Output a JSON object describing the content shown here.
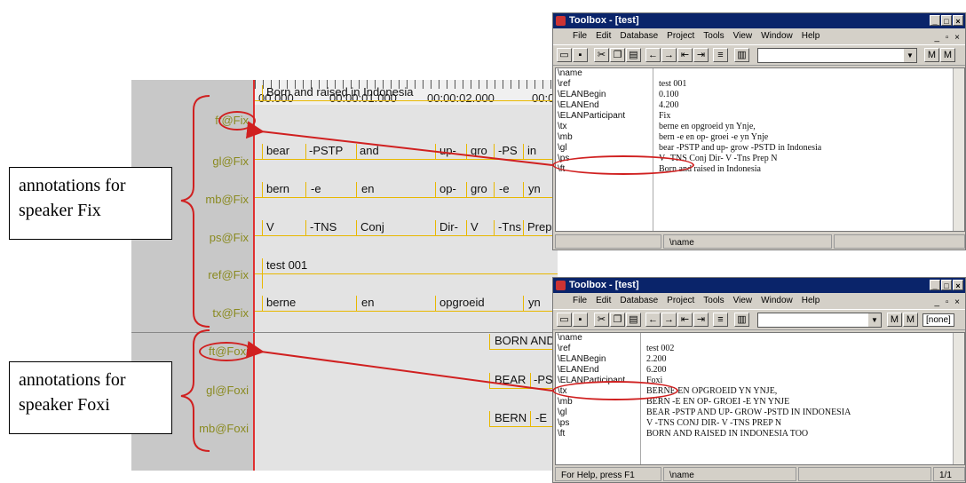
{
  "elan": {
    "ruler": [
      "00.000",
      "00:00:01.000",
      "00:00:02.000",
      "00:0"
    ],
    "tiers": [
      {
        "label": "ft@Fix"
      },
      {
        "label": "gl@Fix"
      },
      {
        "label": "mb@Fix"
      },
      {
        "label": "ps@Fix"
      },
      {
        "label": "ref@Fix"
      },
      {
        "label": "tx@Fix"
      },
      {
        "label": "ft@Foxi"
      },
      {
        "label": "gl@Foxi"
      },
      {
        "label": "mb@Foxi"
      }
    ],
    "ft_fix": "Born and raised in Indonesia",
    "gl_fix": [
      "bear",
      "-PSTP",
      "and",
      "up-",
      "gro",
      "-PS",
      "in"
    ],
    "mb_fix": [
      "bern",
      "-e",
      "en",
      "op-",
      "gro",
      "-e",
      "yn"
    ],
    "ps_fix": [
      "V",
      "-TNS",
      "Conj",
      "Dir-",
      "V",
      "-Tns",
      "Prep"
    ],
    "ref_fix": "test 001",
    "tx_fix": [
      "berne",
      "en",
      "opgroeid",
      "yn"
    ],
    "ft_foxi": "BORN AND",
    "gl_foxi": [
      "BEAR",
      "-PS"
    ],
    "mb_foxi": [
      "BERN",
      "-E"
    ]
  },
  "callouts": {
    "fix": "annotations for speaker Fix",
    "foxi": "annotations for speaker Foxi"
  },
  "toolbox1": {
    "title": "Toolbox - [test]",
    "menu": [
      "File",
      "Edit",
      "Database",
      "Project",
      "Tools",
      "View",
      "Window",
      "Help"
    ],
    "fields": [
      "\\name",
      "\\ref",
      "\\ELANBegin",
      "\\ELANEnd",
      "\\ELANParticipant",
      "\\tx",
      "\\mb",
      "\\gl",
      "\\ps",
      "\\ft"
    ],
    "values": [
      "",
      "test 001",
      "0.100",
      "4.200",
      "Fix",
      "berne    en  opgroeid     yn  Ynje,",
      "bern -e    en  op- groei -e   yn  Ynje",
      "bear -PSTP and  up- grow  -PSTD in   Indonesia",
      "V    -TNS  Conj Dir- V    -Tns  Prep N",
      "Born and raised in Indonesia"
    ],
    "status": "\\name"
  },
  "toolbox2": {
    "title": "Toolbox - [test]",
    "menu": [
      "File",
      "Edit",
      "Database",
      "Project",
      "Tools",
      "View",
      "Window",
      "Help"
    ],
    "combo_value": "[none]",
    "fields": [
      "\\name",
      "\\ref",
      "\\ELANBegin",
      "\\ELANEnd",
      "\\ELANParticipant",
      "\\tx",
      "\\mb",
      "\\gl",
      "\\ps",
      "\\ft"
    ],
    "values": [
      "",
      "test 002",
      "2.200",
      "6.200",
      "Foxi",
      "BERNE    EN  OPGROEID     YN  YNJE,",
      "BERN -E   EN  OP- GROEI -E   YN  YNJE",
      "BEAR -PSTP AND  UP- GROW  -PSTD IN   INDONESIA",
      "V    -TNS  CONJ DIR- V    -TNS  PREP N",
      "BORN AND RAISED IN INDONESIA TOO"
    ],
    "status_help": "For Help, press F1",
    "status_field": "\\name",
    "status_page": "1/1"
  }
}
